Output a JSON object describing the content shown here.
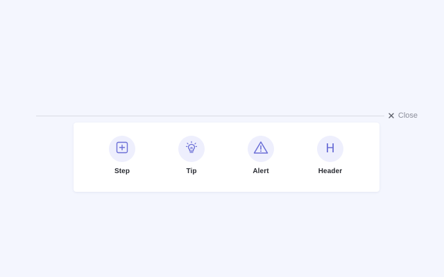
{
  "toolbar": {
    "close_label": "Close"
  },
  "tiles": [
    {
      "label": "Step",
      "icon": "plus-square-icon"
    },
    {
      "label": "Tip",
      "icon": "lightbulb-icon"
    },
    {
      "label": "Alert",
      "icon": "warning-triangle-icon"
    },
    {
      "label": "Header",
      "icon": "heading-icon",
      "glyph": "H"
    }
  ],
  "colors": {
    "background": "#f4f6fe",
    "accent": "#6b6fd6",
    "icon_circle": "#eeeffd"
  }
}
